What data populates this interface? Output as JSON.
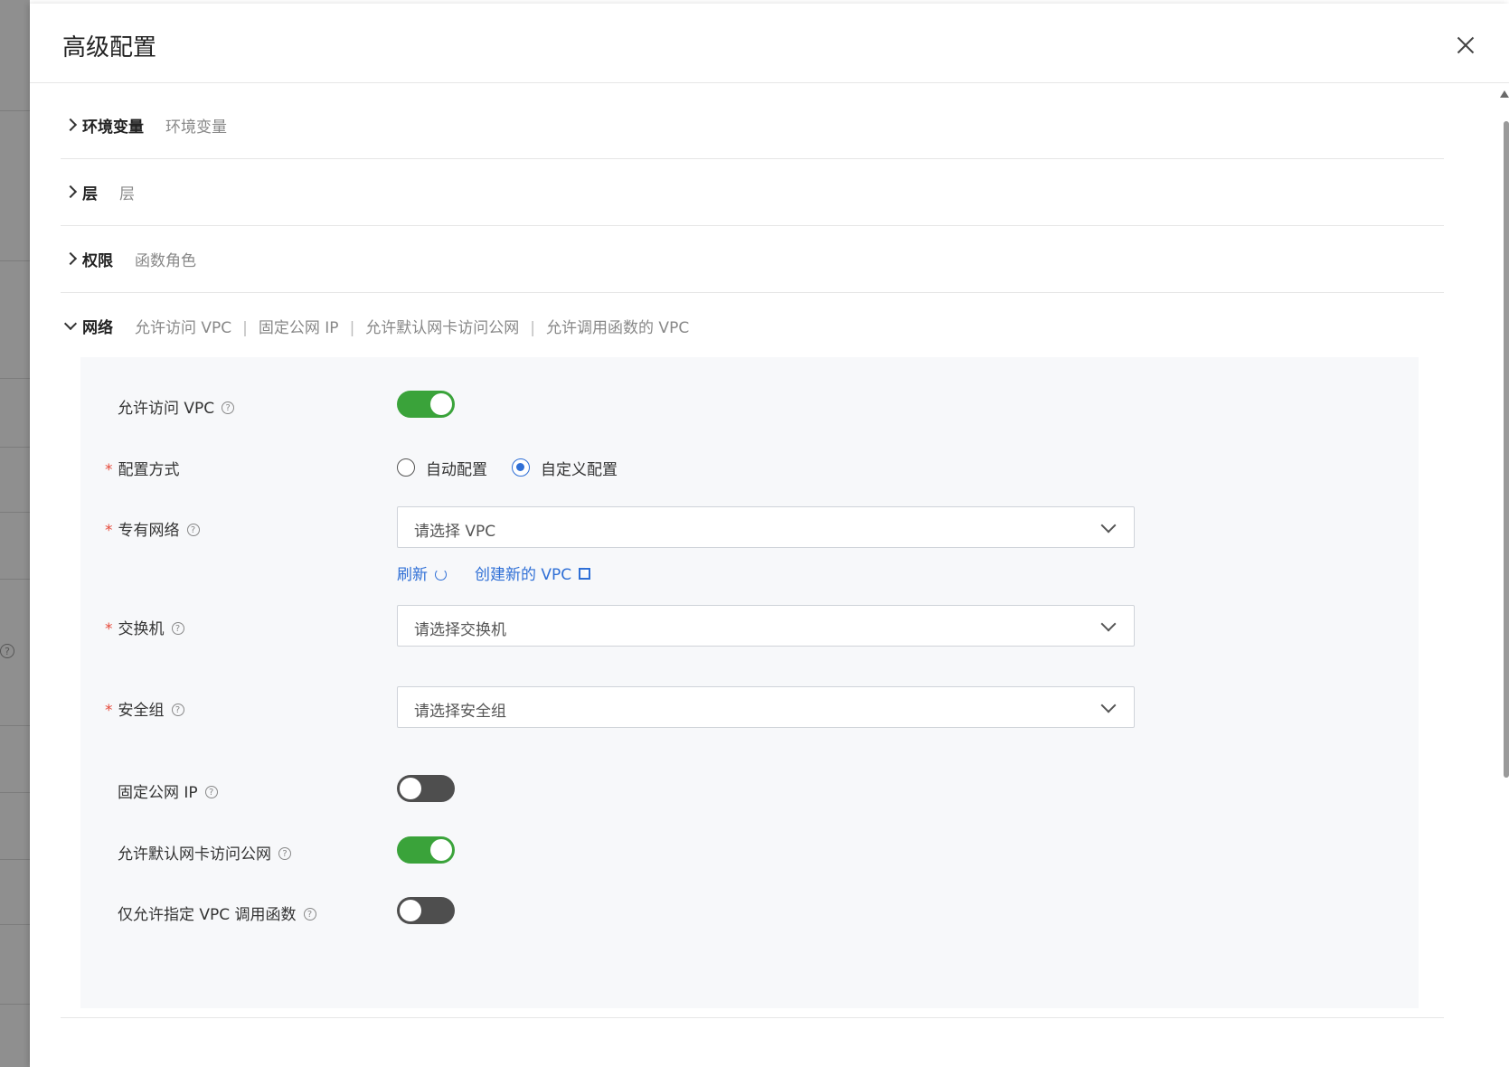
{
  "drawer": {
    "title": "高级配置"
  },
  "sections": [
    {
      "title": "环境变量",
      "subtitles": [
        "环境变量"
      ],
      "expanded": false
    },
    {
      "title": "层",
      "subtitles": [
        "层"
      ],
      "expanded": false
    },
    {
      "title": "权限",
      "subtitles": [
        "函数角色"
      ],
      "expanded": false
    },
    {
      "title": "网络",
      "subtitles": [
        "允许访问 VPC",
        "固定公网 IP",
        "允许默认网卡访问公网",
        "允许调用函数的 VPC"
      ],
      "expanded": true
    }
  ],
  "network": {
    "allow_vpc": {
      "label": "允许访问 VPC",
      "enabled": true
    },
    "config_mode": {
      "label": "配置方式",
      "required": true,
      "options": [
        "自动配置",
        "自定义配置"
      ],
      "selected": "自定义配置"
    },
    "vpc": {
      "label": "专有网络",
      "required": true,
      "placeholder": "请选择 VPC",
      "refresh_label": "刷新",
      "create_label": "创建新的 VPC"
    },
    "vswitch": {
      "label": "交换机",
      "required": true,
      "placeholder": "请选择交换机"
    },
    "security_group": {
      "label": "安全组",
      "required": true,
      "placeholder": "请选择安全组"
    },
    "static_ip": {
      "label": "固定公网 IP",
      "enabled": false
    },
    "default_nic_internet": {
      "label": "允许默认网卡访问公网",
      "enabled": true
    },
    "vpc_only_invoke": {
      "label": "仅允许指定 VPC 调用函数",
      "enabled": false
    }
  },
  "colors": {
    "toggle_on": "#3aa33a",
    "toggle_off": "#4e4e4e",
    "link": "#2f6fd6",
    "required": "#e64a3b"
  },
  "icons": {
    "close": "close-icon",
    "help": "question-circle-icon",
    "chevron": "chevron-icon",
    "refresh": "refresh-icon",
    "external": "external-link-icon",
    "caret": "chevron-down-icon"
  }
}
